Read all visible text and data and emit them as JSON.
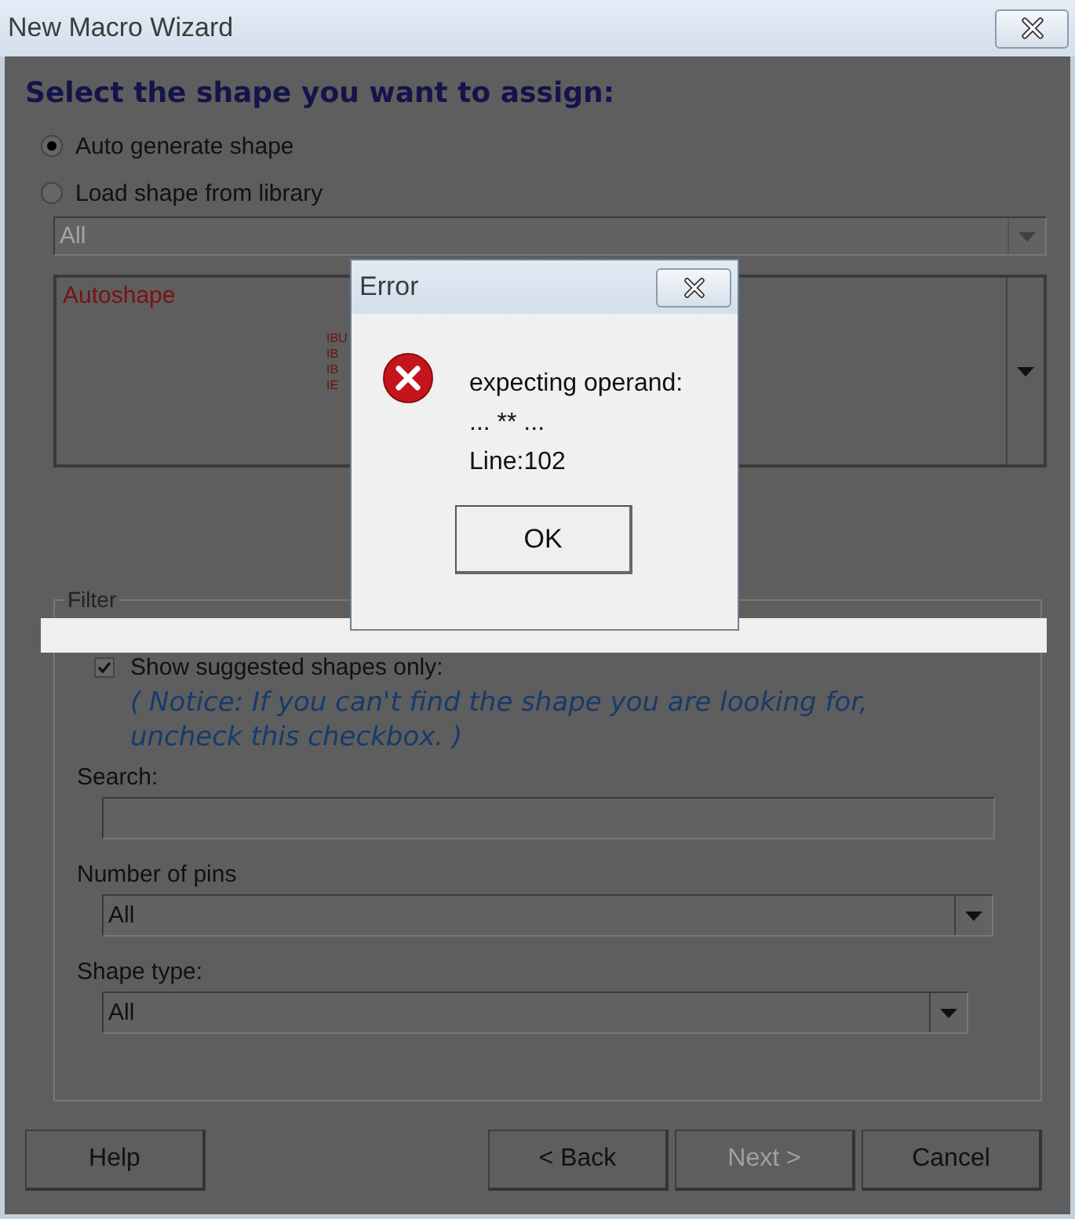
{
  "window": {
    "title": "New Macro Wizard"
  },
  "heading": "Select the shape you want to assign:",
  "shape_source": [
    {
      "label": "Auto generate shape",
      "selected": true
    },
    {
      "label": "Load shape from library",
      "selected": false
    }
  ],
  "library": {
    "value": "All",
    "disabled": true
  },
  "preview": {
    "title": "Autoshape",
    "labels": [
      "IBU",
      "IB",
      "IB",
      "IE"
    ]
  },
  "filter": {
    "legend": "Filter",
    "suggested_only": {
      "label": "Show suggested shapes only:",
      "checked": true
    },
    "notice": "( Notice: If you can't find the shape you are looking for, uncheck this checkbox. )",
    "search": {
      "label": "Search:"
    },
    "pins": {
      "label": "Number of pins",
      "value": "All"
    },
    "shape_type": {
      "label": "Shape type:",
      "value": "All"
    }
  },
  "buttons": [
    {
      "label": "Help",
      "disabled": false
    },
    {
      "label": "< Back",
      "disabled": false
    },
    {
      "label": "Next >",
      "disabled": true
    },
    {
      "label": "Cancel",
      "disabled": false
    }
  ],
  "error_dialog": {
    "title": "Error",
    "message": [
      "expecting operand:",
      "... ** ...",
      "Line:102"
    ],
    "button": "OK"
  }
}
